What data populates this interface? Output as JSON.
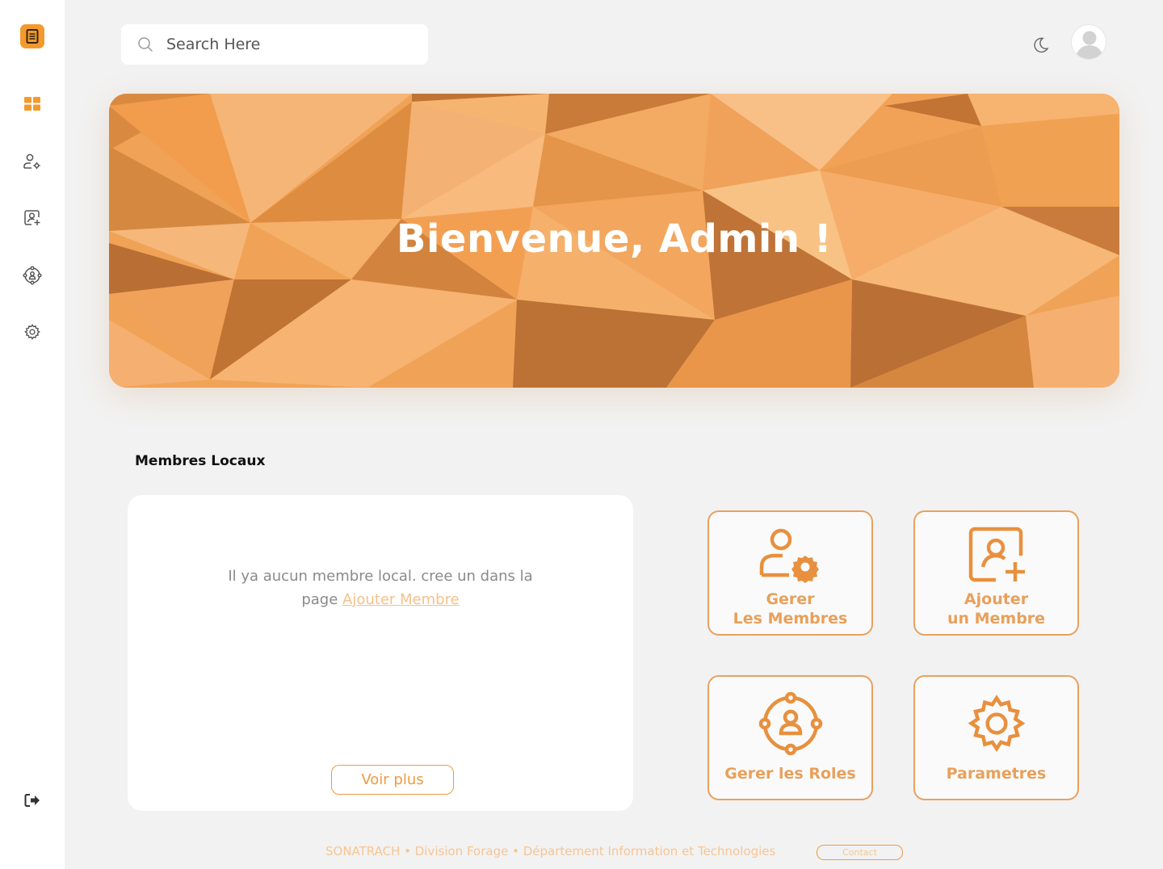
{
  "colors": {
    "accent": "#f39a2e",
    "tile_border": "#e8a160",
    "tile_text": "#e8a05a",
    "banner_base": "#f0a356"
  },
  "sidebar": {
    "logo_icon": "document-icon",
    "items": [
      {
        "name": "dashboard",
        "icon": "grid-icon",
        "active": true
      },
      {
        "name": "manage-members",
        "icon": "user-gear-icon"
      },
      {
        "name": "add-member",
        "icon": "user-add-icon"
      },
      {
        "name": "manage-roles",
        "icon": "roles-icon"
      },
      {
        "name": "settings",
        "icon": "gear-icon"
      }
    ],
    "logout_icon": "logout-icon"
  },
  "header": {
    "search_placeholder": "Search Here",
    "theme_icon": "moon-icon",
    "avatar_icon": "avatar-icon"
  },
  "banner": {
    "title": "Bienvenue, Admin !"
  },
  "members": {
    "section_title": "Membres Locaux",
    "empty_text": "Il ya aucun membre local. cree un dans la page",
    "empty_link": "Ajouter Membre",
    "voir_plus": "Voir plus"
  },
  "tiles": [
    {
      "line1": "Gerer",
      "line2": "Les Membres",
      "icon": "user-gear-icon"
    },
    {
      "line1": "Ajouter",
      "line2": "un Membre",
      "icon": "user-add-icon"
    },
    {
      "line1": "Gerer les Roles",
      "line2": "",
      "icon": "roles-icon"
    },
    {
      "line1": "Parametres",
      "line2": "",
      "icon": "gear-icon"
    }
  ],
  "footer": {
    "text": "SONATRACH • Division Forage • Département Information et Technologies",
    "contact": "Contact"
  }
}
